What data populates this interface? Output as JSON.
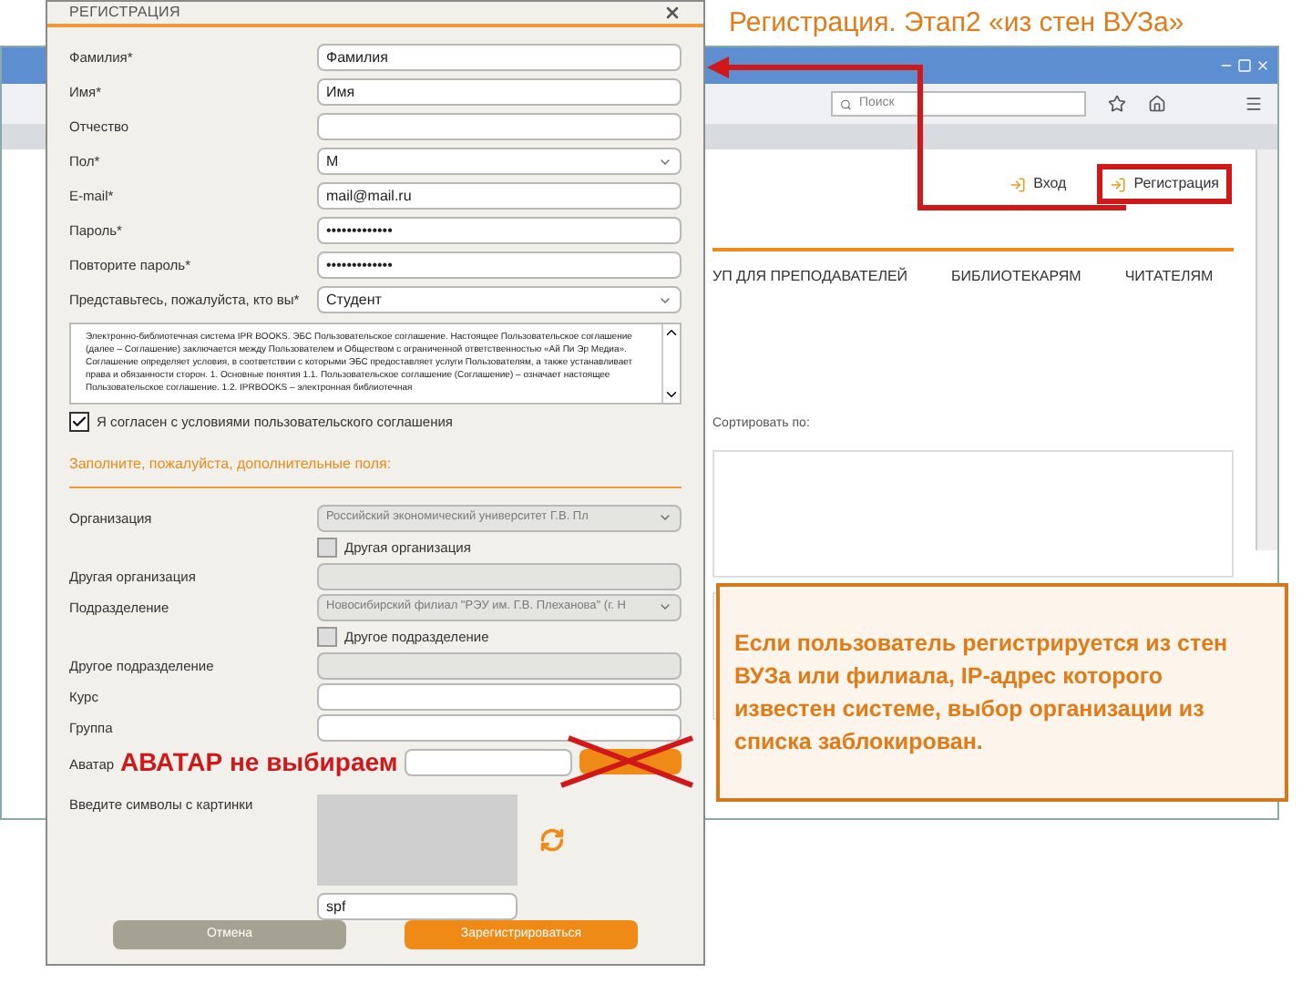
{
  "slide_title": "Регистрация. Этап2 «из стен ВУЗа»",
  "browser": {
    "search_placeholder": "Поиск",
    "links": [
      {
        "label": "Вход",
        "highlighted": false
      },
      {
        "label": "Регистрация",
        "highlighted": true
      }
    ],
    "nav": [
      "УП ДЛЯ ПРЕПОДАВАТЕЛЕЙ",
      "БИБЛИОТЕКАРЯМ",
      "ЧИТАТЕЛЯМ"
    ],
    "sort_label": "Сортировать по:"
  },
  "dialog": {
    "title": "РЕГИСТРАЦИЯ",
    "fields": [
      {
        "label": "Фамилия*",
        "kind": "text",
        "value": "Фамилия"
      },
      {
        "label": "Имя*",
        "kind": "text",
        "value": "Имя"
      },
      {
        "label": "Отчество",
        "kind": "text"
      },
      {
        "label": "Пол*",
        "kind": "select",
        "value": "М"
      },
      {
        "label": "E-mail*",
        "kind": "text",
        "value": "mail@mail.ru"
      },
      {
        "label": "Пароль*",
        "kind": "text",
        "value": "•••••••••••••"
      },
      {
        "label": "Повторите пароль*",
        "kind": "text",
        "value": "•••••••••••••"
      },
      {
        "label": "Представьтесь, пожалуйста, кто вы*",
        "kind": "select",
        "value": "Студент"
      }
    ],
    "agreement": "Электронно-библиотечная система IPR BOOKS. ЭБС Пользовательское соглашение. Настоящее Пользовательское соглашение (далее – Соглашение) заключается между Пользователем и Обществом с ограниченной ответственностью «Ай Пи Эр Медиа». Соглашение определяет условия, в соответствии с которыми ЭБС предоставляет услуги Пользователям, а также устанавливает права и обязанности сторон. 1. Основные понятия 1.1. Пользовательское соглашение (Соглашение) – означает настоящее Пользовательское соглашение. 1.2. IPRBOOKS – электронная библиотечная",
    "agree": {
      "label": "Я согласен с условиями пользовательского соглашения",
      "checked": true
    },
    "section_heading": "Заполните, пожалуйста, дополнительные поля:",
    "extra_fields": [
      {
        "kind": "select",
        "label": "Организация",
        "value": "Российский экономический университет Г.В. Пл",
        "disabled": true
      },
      {
        "kind": "checkbox",
        "label": "Другая организация",
        "checked": false
      },
      {
        "kind": "text",
        "label": "Другая организация",
        "disabled": true
      },
      {
        "kind": "select",
        "label": "Подразделение",
        "value": "Новосибирский филиал \"РЭУ им. Г.В. Плеханова\" (г. Н",
        "disabled": true
      },
      {
        "kind": "checkbox",
        "label": "Другое подразделение",
        "checked": false
      },
      {
        "kind": "text",
        "label": "Другое подразделение",
        "disabled": true
      },
      {
        "kind": "text",
        "label": "Курс",
        "disabled": false
      },
      {
        "kind": "text",
        "label": "Группа",
        "disabled": false
      },
      {
        "kind": "file",
        "label": "Аватар"
      }
    ],
    "captcha": {
      "label": "Введите символы с картинки",
      "value": "spf"
    },
    "buttons": [
      {
        "label": "Отмена",
        "kind": "secondary"
      },
      {
        "label": "Зарегистрироваться",
        "kind": "primary"
      }
    ]
  },
  "annotations": {
    "avatar_note": "АВАТАР не выбираем",
    "callout": "Если пользователь регистрируется из стен ВУЗа или филиала, IP-адрес которого известен системе, выбор организации из списка заблокирован."
  }
}
